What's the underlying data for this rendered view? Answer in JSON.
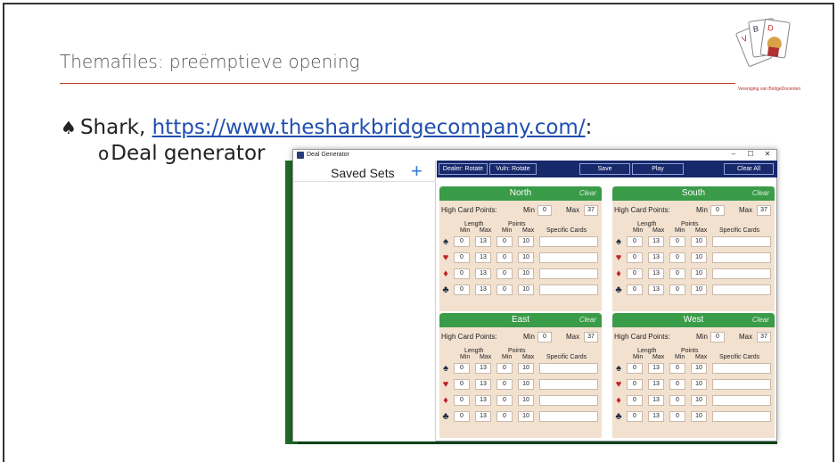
{
  "slide": {
    "title": "Themafiles: preëmptieve opening",
    "logo_caption": "Vereniging van BridgeDocenten",
    "bullet1_prefix": "Shark, ",
    "bullet1_link": "https://www.thesharkbridgecompany.com/",
    "bullet1_suffix": ":",
    "bullet2": "Deal generator"
  },
  "window": {
    "title": "Deal Generator",
    "minimize": "–",
    "maximize": "☐",
    "close": "✕"
  },
  "saved_sets": {
    "label": "Saved Sets",
    "add": "+"
  },
  "toolbar": {
    "dealer": "Dealer: Rotate",
    "vuln": "Vuln: Rotate",
    "save": "Save",
    "play": "Play",
    "clear_all": "Clear All"
  },
  "labels": {
    "hcp": "High Card Points:",
    "min": "Min",
    "max": "Max",
    "length": "Length",
    "points": "Points",
    "specific": "Specific Cards",
    "clear": "Clear"
  },
  "hands": {
    "north": {
      "name": "North",
      "hcp_min": "0",
      "hcp_max": "37",
      "rows": [
        [
          "0",
          "13",
          "0",
          "10"
        ],
        [
          "0",
          "13",
          "0",
          "10"
        ],
        [
          "0",
          "13",
          "0",
          "10"
        ],
        [
          "0",
          "13",
          "0",
          "10"
        ]
      ]
    },
    "south": {
      "name": "South",
      "hcp_min": "0",
      "hcp_max": "37",
      "rows": [
        [
          "0",
          "13",
          "0",
          "10"
        ],
        [
          "0",
          "13",
          "0",
          "10"
        ],
        [
          "0",
          "13",
          "0",
          "10"
        ],
        [
          "0",
          "13",
          "0",
          "10"
        ]
      ]
    },
    "east": {
      "name": "East",
      "hcp_min": "0",
      "hcp_max": "37",
      "rows": [
        [
          "0",
          "13",
          "0",
          "10"
        ],
        [
          "0",
          "13",
          "0",
          "10"
        ],
        [
          "0",
          "13",
          "0",
          "10"
        ],
        [
          "0",
          "13",
          "0",
          "10"
        ]
      ]
    },
    "west": {
      "name": "West",
      "hcp_min": "0",
      "hcp_max": "37",
      "rows": [
        [
          "0",
          "13",
          "0",
          "10"
        ],
        [
          "0",
          "13",
          "0",
          "10"
        ],
        [
          "0",
          "13",
          "0",
          "10"
        ],
        [
          "0",
          "13",
          "0",
          "10"
        ]
      ]
    }
  },
  "suits": [
    "♠",
    "♥",
    "♦",
    "♣"
  ]
}
